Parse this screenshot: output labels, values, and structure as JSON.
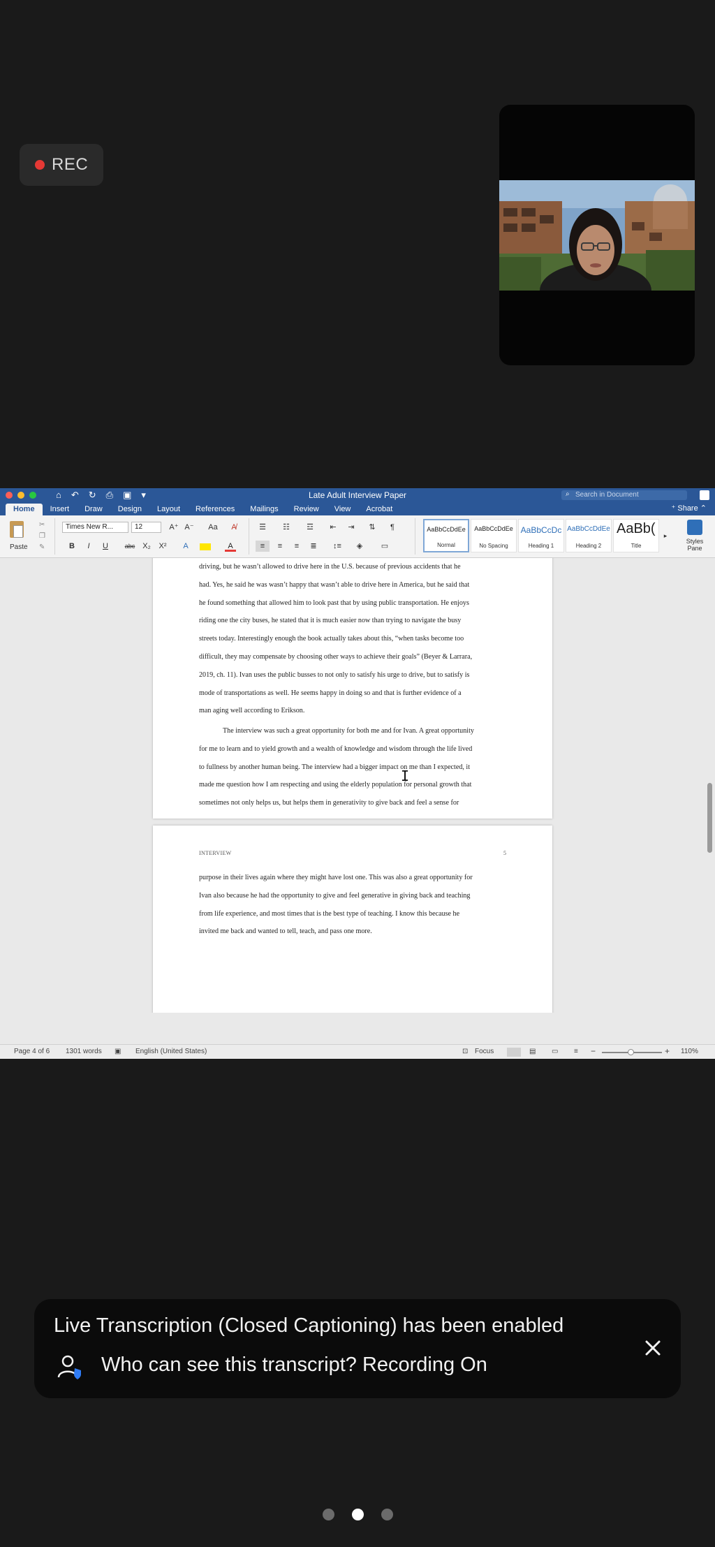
{
  "recording": {
    "label": "REC",
    "color": "#e53935"
  },
  "word": {
    "doc_title": "Late Adult Interview Paper",
    "search_placeholder": "Search in Document",
    "tabs": [
      "Home",
      "Insert",
      "Draw",
      "Design",
      "Layout",
      "References",
      "Mailings",
      "Review",
      "View",
      "Acrobat"
    ],
    "active_tab": "Home",
    "share_label": "Share",
    "paste_label": "Paste",
    "font_name": "Times New R...",
    "font_size": "12",
    "styles": [
      {
        "sample": "AaBbCcDdEe",
        "name": "Normal"
      },
      {
        "sample": "AaBbCcDdEe",
        "name": "No Spacing"
      },
      {
        "sample": "AaBbCcDc",
        "name": "Heading 1"
      },
      {
        "sample": "AaBbCcDdEe",
        "name": "Heading 2"
      },
      {
        "sample": "AaBb(",
        "name": "Title"
      }
    ],
    "styles_pane_label": "Styles Pane",
    "page1_lines": [
      "driving, but he wasn’t allowed to drive here in the U.S. because of previous accidents that he",
      "had. Yes, he said he was wasn’t happy that wasn’t able to drive here in America, but he said that",
      "he found something that allowed him to look past that by using public transportation. He enjoys",
      "riding one the city buses, he stated that it is much easier now than trying to navigate the busy",
      "streets today. Interestingly enough the book actually takes about this, “when tasks become too",
      "difficult, they may compensate by choosing other ways to achieve their goals” (Beyer & Larrara,",
      "2019, ch. 11). Ivan uses the public busses to not only to satisfy his urge to drive, but to satisfy is",
      "mode of transportations as well. He seems happy in doing so and that is further evidence of a",
      "man aging well according to Erikson."
    ],
    "page1_para2_lines": [
      "The interview was such a great opportunity for both me and for Ivan. A great opportunity",
      "for me to learn and to yield growth and a wealth of knowledge and wisdom through the life lived",
      "to fullness by another human being. The interview had a bigger impact on me than I expected, it",
      "made me question how I am respecting and using the elderly population for personal growth that",
      "sometimes not only helps us, but helps them in generativity to give back and feel a sense for"
    ],
    "page2_header_left": "INTERVIEW",
    "page2_header_right": "5",
    "page2_lines": [
      "purpose in their lives again where they might have lost one. This was also a great opportunity for",
      "Ivan also because he had the opportunity to give and feel generative in giving back and teaching",
      "from life experience, and most times that is the best type of teaching. I know this because he",
      "invited me back and wanted to tell, teach, and pass one more."
    ],
    "status": {
      "page": "Page 4 of 6",
      "words": "1301 words",
      "language": "English (United States)",
      "focus": "Focus",
      "zoom": "110%"
    }
  },
  "transcription": {
    "line1": "Live Transcription (Closed Captioning) has been enabled",
    "line2": "Who can see this transcript? Recording On"
  },
  "pager": {
    "count": 3,
    "active": 2
  }
}
